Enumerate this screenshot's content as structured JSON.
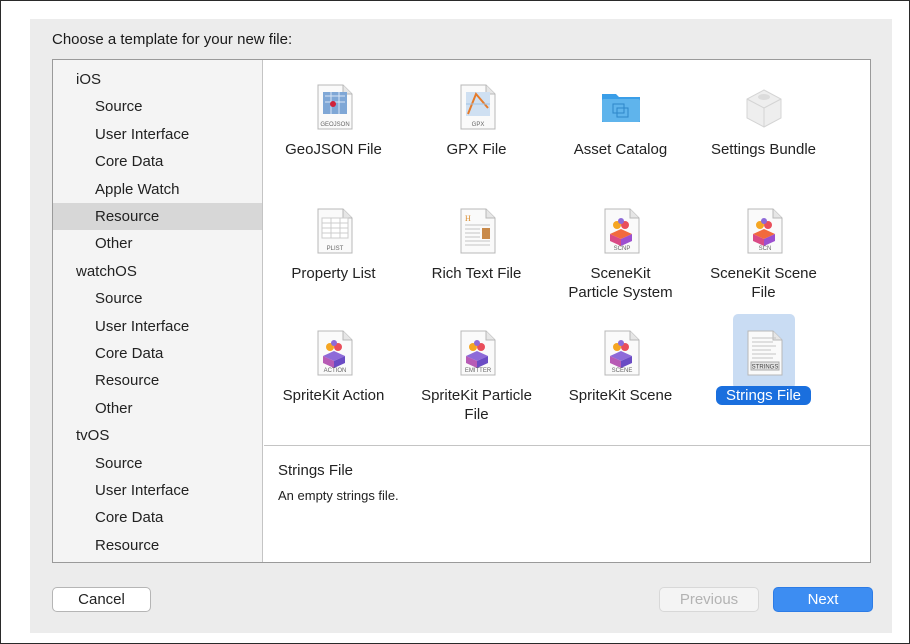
{
  "dialog": {
    "prompt": "Choose a template for your new file:"
  },
  "sidebar": {
    "items": [
      {
        "label": "iOS",
        "kind": "platform"
      },
      {
        "label": "Source",
        "kind": "category"
      },
      {
        "label": "User Interface",
        "kind": "category"
      },
      {
        "label": "Core Data",
        "kind": "category"
      },
      {
        "label": "Apple Watch",
        "kind": "category"
      },
      {
        "label": "Resource",
        "kind": "category",
        "selected": true
      },
      {
        "label": "Other",
        "kind": "category"
      },
      {
        "label": "watchOS",
        "kind": "platform"
      },
      {
        "label": "Source",
        "kind": "category"
      },
      {
        "label": "User Interface",
        "kind": "category"
      },
      {
        "label": "Core Data",
        "kind": "category"
      },
      {
        "label": "Resource",
        "kind": "category"
      },
      {
        "label": "Other",
        "kind": "category"
      },
      {
        "label": "tvOS",
        "kind": "platform"
      },
      {
        "label": "Source",
        "kind": "category"
      },
      {
        "label": "User Interface",
        "kind": "category"
      },
      {
        "label": "Core Data",
        "kind": "category"
      },
      {
        "label": "Resource",
        "kind": "category"
      }
    ]
  },
  "templates": [
    {
      "label": "GeoJSON File",
      "icon": "geojson-file-icon",
      "badge": "GEOJSON"
    },
    {
      "label": "GPX File",
      "icon": "gpx-file-icon",
      "badge": "GPX"
    },
    {
      "label": "Asset Catalog",
      "icon": "folder-icon",
      "badge": ""
    },
    {
      "label": "Settings Bundle",
      "icon": "settings-bundle-icon",
      "badge": ""
    },
    {
      "label": "Property List",
      "icon": "plist-file-icon",
      "badge": "PLIST"
    },
    {
      "label": "Rich Text File",
      "icon": "rich-text-file-icon",
      "badge": ""
    },
    {
      "label": "SceneKit Particle System",
      "icon": "scenekit-particle-icon",
      "badge": "SCNP"
    },
    {
      "label": "SceneKit Scene File",
      "icon": "scenekit-scene-icon",
      "badge": "SCN"
    },
    {
      "label": "SpriteKit Action",
      "icon": "spritekit-action-icon",
      "badge": "ACTION"
    },
    {
      "label": "SpriteKit Particle File",
      "icon": "spritekit-emitter-icon",
      "badge": "EMITTER"
    },
    {
      "label": "SpriteKit Scene",
      "icon": "spritekit-scene-icon",
      "badge": "SCENE"
    },
    {
      "label": "Strings File",
      "icon": "strings-file-icon",
      "badge": "STRINGS",
      "selected": true
    }
  ],
  "description": {
    "title": "Strings File",
    "text": "An empty strings file."
  },
  "buttons": {
    "cancel": "Cancel",
    "previous": "Previous",
    "next": "Next"
  },
  "colors": {
    "accent": "#3d8df2",
    "selection": "#1a6fde",
    "folder": "#5fb4ec"
  }
}
